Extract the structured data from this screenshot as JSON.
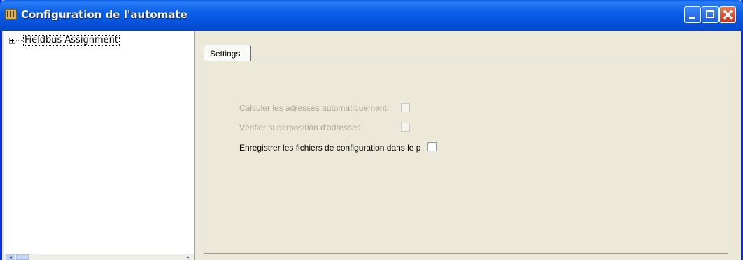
{
  "window": {
    "title": "Configuration de l'automate",
    "icon": "config-app-icon",
    "controls": {
      "minimize": "minimize-icon",
      "maximize": "maximize-icon",
      "close": "close-icon"
    }
  },
  "tree": {
    "items": [
      {
        "label": "Fieldbus Assignment",
        "expanded": false
      }
    ]
  },
  "tabs": [
    {
      "label": "Settings",
      "active": true
    }
  ],
  "settings": {
    "calc_addresses": {
      "label": "Calculer les adresses automatiquement:",
      "checked": false,
      "enabled": false
    },
    "verify_overlap": {
      "label": "Vérifier superposition d'adresses:",
      "checked": false,
      "enabled": false
    },
    "save_config": {
      "label": "Enregistrer les fichiers de configuration dans le p",
      "checked": false,
      "enabled": true
    }
  }
}
